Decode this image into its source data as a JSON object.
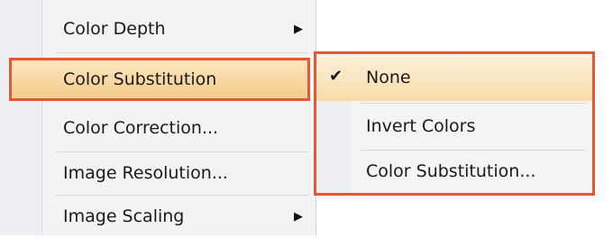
{
  "menu": {
    "items": [
      {
        "label": "Color Depth",
        "has_submenu": true,
        "selected": false
      },
      {
        "label": "Color Substitution",
        "has_submenu": false,
        "selected": true
      },
      {
        "label": "Color Correction...",
        "has_submenu": false,
        "selected": false
      },
      {
        "label": "Image Resolution...",
        "has_submenu": false,
        "selected": false
      },
      {
        "label": "Image Scaling",
        "has_submenu": true,
        "selected": false
      }
    ]
  },
  "submenu": {
    "items": [
      {
        "label": "None",
        "checked": true
      },
      {
        "label": "Invert Colors",
        "checked": false
      },
      {
        "label": "Color Substitution...",
        "checked": false
      }
    ]
  },
  "icons": {
    "submenu_arrow": "chevron-right-icon",
    "check": "checkmark-icon"
  },
  "colors": {
    "highlight_border": "#e05a35",
    "highlight_fill": "#f6cc8b"
  }
}
